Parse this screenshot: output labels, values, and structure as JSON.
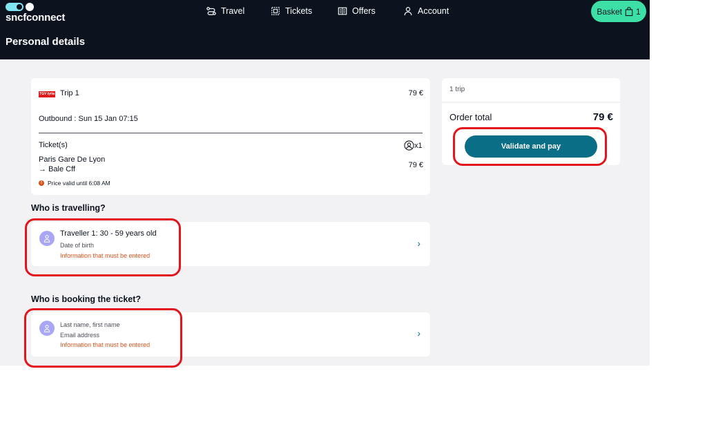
{
  "brand": {
    "name": "sncfconnect"
  },
  "nav": {
    "travel": "Travel",
    "tickets": "Tickets",
    "offers": "Offers",
    "account": "Account",
    "basket_label": "Basket",
    "basket_count": "1"
  },
  "page": {
    "title": "Personal details"
  },
  "trip": {
    "carrier_logo": "TGV lyria",
    "name": "Trip 1",
    "price": "79 €",
    "outbound": "Outbound : Sun 15 Jan 07:15",
    "tickets_label": "Ticket(s)",
    "passenger_count": "x1",
    "origin": "Paris Gare De Lyon",
    "destination": "Bale Cff",
    "arrow": "→",
    "ticket_price": "79 €",
    "warning_icon": "!",
    "price_validity": "Price valid until 6:08 AM"
  },
  "travellers": {
    "section_title": "Who is travelling?",
    "traveller_title": "Traveller 1:  30 - 59 years old",
    "dob_label": "Date of birth",
    "required_note": "Information that must be entered"
  },
  "booker": {
    "section_title": "Who is booking the ticket?",
    "name_label": "Last name, first name",
    "email_label": "Email address",
    "required_note": "Information that must be entered"
  },
  "summary": {
    "trip_count": "1 trip",
    "order_total_label": "Order total",
    "order_total_value": "79 €",
    "validate_button": "Validate and pay"
  },
  "colors": {
    "header_bg": "#0c131f",
    "basket_bg": "#3cdfa6",
    "primary_button": "#0a6e86",
    "warning": "#d4531a",
    "highlight": "#e3141b",
    "avatar": "#a9a6f5"
  },
  "icons": [
    "train-icon",
    "ticket-icon",
    "offers-icon",
    "account-icon",
    "basket-icon",
    "passenger-icon",
    "warning-icon",
    "user-avatar-icon",
    "chevron-right-icon"
  ]
}
